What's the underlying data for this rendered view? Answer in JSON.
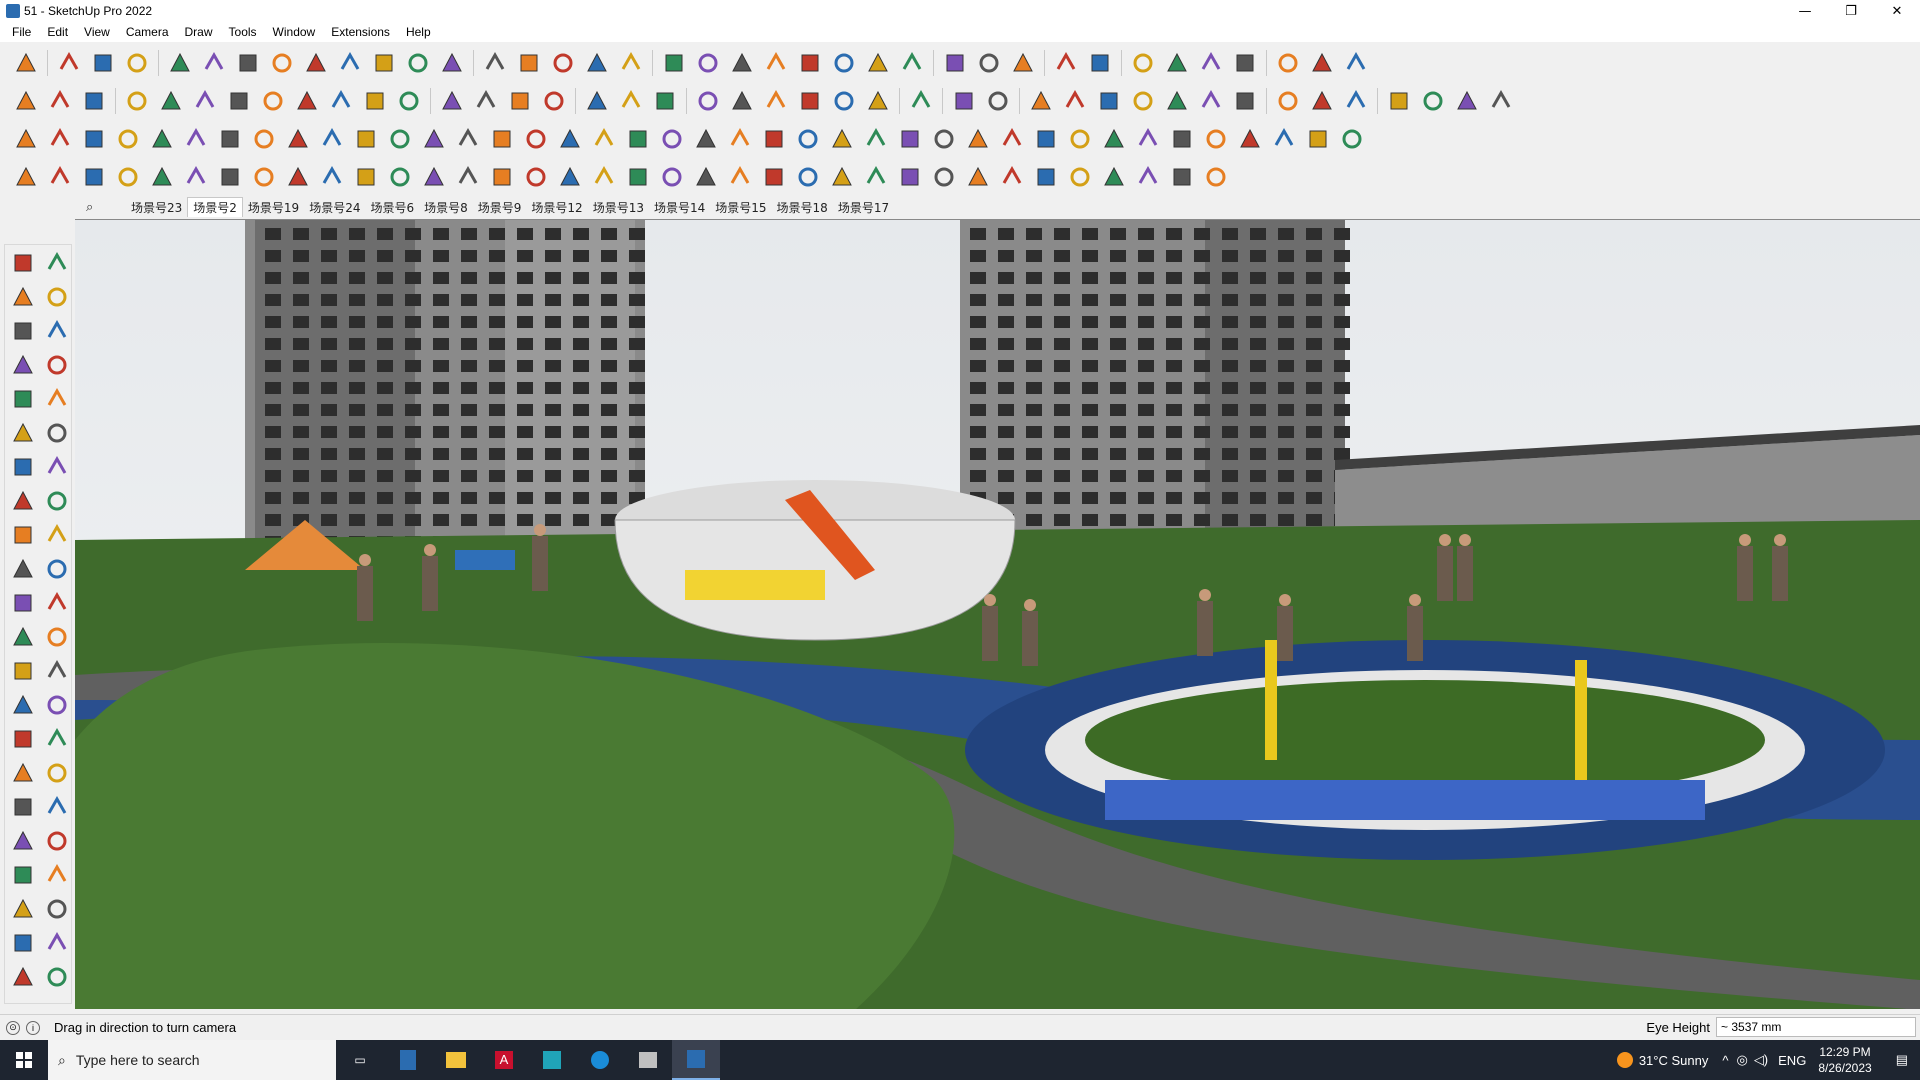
{
  "window": {
    "title": "51 - SketchUp Pro 2022"
  },
  "menu": [
    "File",
    "Edit",
    "View",
    "Camera",
    "Draw",
    "Tools",
    "Window",
    "Extensions",
    "Help"
  ],
  "scenes": {
    "tabs": [
      "场景号23",
      "场景号2",
      "场景号19",
      "场景号24",
      "场景号6",
      "场景号8",
      "场景号9",
      "场景号12",
      "场景号13",
      "场景号14",
      "场景号15",
      "场景号18",
      "场景号17"
    ],
    "active_index": 1
  },
  "status": {
    "message": "Drag in direction to turn camera",
    "vcb_label": "Eye Height",
    "vcb_value": "~ 3537 mm"
  },
  "taskbar": {
    "search_placeholder": "Type here to search",
    "weather": "31°C  Sunny",
    "language": "ENG",
    "time": "12:29 PM",
    "date": "8/26/2023"
  },
  "colors": {
    "accent": "#2b6cb0",
    "taskbar": "#1e2530",
    "grass": "#3f6b2c",
    "paving": "#2a4f8f"
  }
}
